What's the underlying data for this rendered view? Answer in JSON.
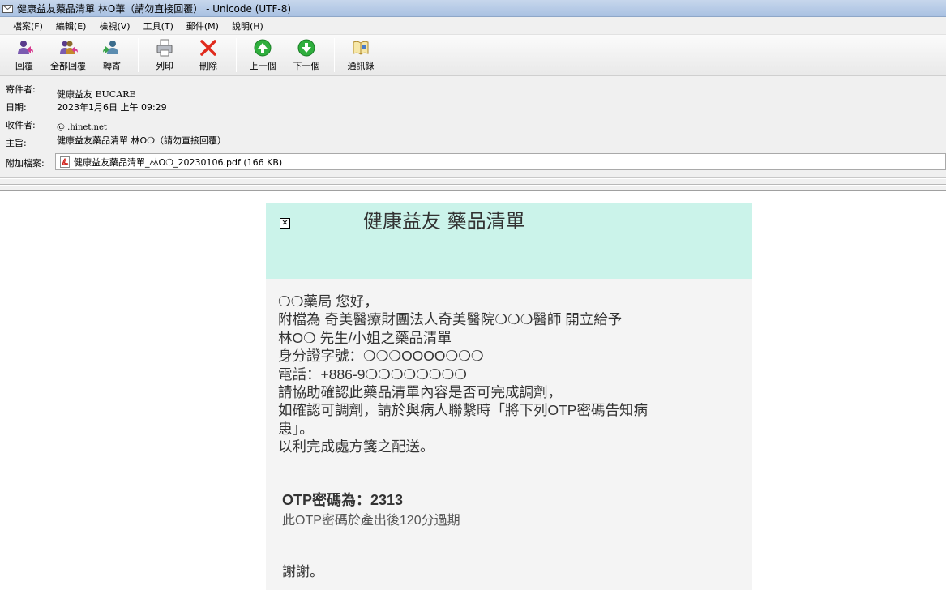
{
  "window": {
    "title": "健康益友藥品清單 林O華（請勿直接回覆） - Unicode (UTF-8)"
  },
  "menu": [
    "檔案(F)",
    "編輯(E)",
    "檢視(V)",
    "工具(T)",
    "郵件(M)",
    "說明(H)"
  ],
  "toolbar": {
    "reply": "回覆",
    "reply_all": "全部回覆",
    "forward": "轉寄",
    "print": "列印",
    "delete": "刪除",
    "previous": "上一個",
    "next": "下一個",
    "contacts": "通訊錄"
  },
  "header": {
    "from_label": "寄件者:",
    "from_value": "健康益友 EUCARE",
    "date_label": "日期:",
    "date_value": "2023年1月6日 上午 09:29",
    "to_label": "收件者:",
    "to_value": "@ .hinet.net",
    "subject_label": "主旨:",
    "subject_value": "健康益友藥品清單 林O❍（請勿直接回覆）",
    "attachment_label": "附加檔案:",
    "attachment_value": "健康益友藥品清單_林O❍_20230106.pdf (166 KB)"
  },
  "message": {
    "title": "健康益友 藥品清單",
    "lines": [
      "❍❍藥局 您好，",
      " 附檔為 奇美醫療財團法人奇美醫院❍❍❍醫師 開立給予",
      " 林O❍ 先生/小姐之藥品清單",
      " 身分證字號：❍❍❍OOOO❍❍❍",
      " 電話：+886-9❍❍❍❍❍❍❍❍",
      " 請協助確認此藥品清單內容是否可完成調劑，",
      " 如確認可調劑，請於與病人聯繫時「將下列OTP密碼告知病",
      " 患」。",
      " 以利完成處方箋之配送。"
    ],
    "otp": "OTP密碼為：2313",
    "otp_note": "此OTP密碼於產出後120分過期",
    "thanks": "謝謝。"
  }
}
